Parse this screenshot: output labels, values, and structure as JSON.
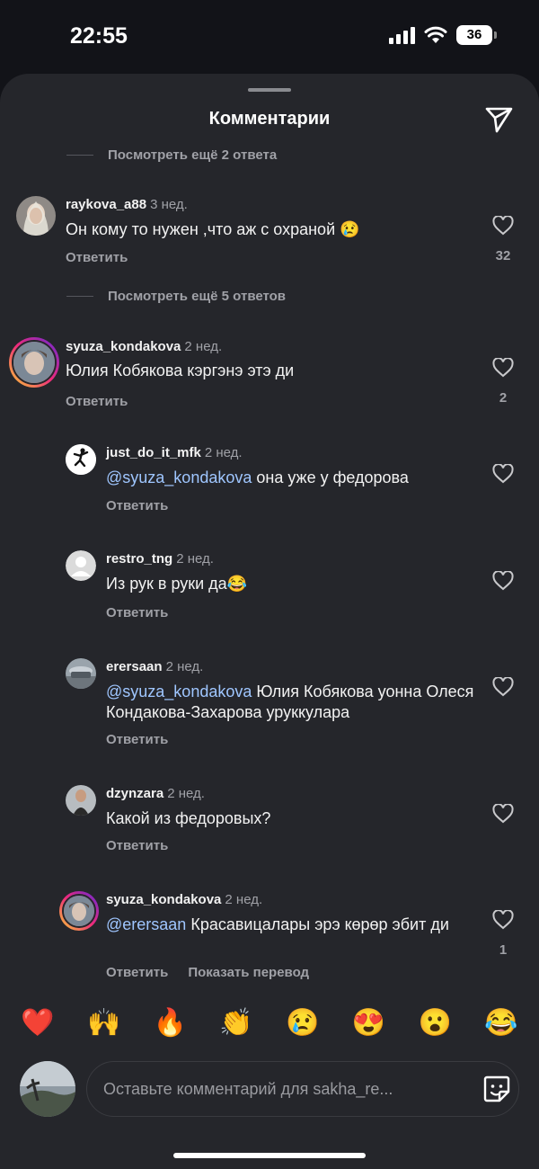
{
  "status": {
    "time": "22:55",
    "battery": "36"
  },
  "sheet": {
    "title": "Комментарии"
  },
  "view_more_1": "Посмотреть ещё 2 ответа",
  "view_more_2": "Посмотреть ещё 5 ответов",
  "comments": [
    {
      "user": "raykova_a88",
      "time": "3 нед.",
      "text": "Он кому то нужен ,что аж с охраной 😢",
      "reply": "Ответить",
      "likes": "32"
    },
    {
      "user": "syuza_kondakova",
      "time": "2 нед.",
      "text": "Юлия Кобякова кэргэнэ этэ ди",
      "reply": "Ответить",
      "likes": "2"
    },
    {
      "user": "just_do_it_mfk",
      "time": "2 нед.",
      "mention": "@syuza_kondakova",
      "text": " она уже у федорова",
      "reply": "Ответить"
    },
    {
      "user": "restro_tng",
      "time": "2 нед.",
      "text": "Из рук в руки да😂",
      "reply": "Ответить"
    },
    {
      "user": "erersaan",
      "time": "2 нед.",
      "mention": "@syuza_kondakova",
      "text": " Юлия Кобякова уонна Олеся Кондакова-Захарова уруккулара",
      "reply": "Ответить"
    },
    {
      "user": "dzynzara",
      "time": "2 нед.",
      "text": "Какой из федоровых?",
      "reply": "Ответить"
    },
    {
      "user": "syuza_kondakova",
      "time": "2 нед.",
      "mention": "@erersaan",
      "text": " Красавицалары эрэ көрөр эбит ди",
      "reply": "Ответить",
      "translate": "Показать перевод",
      "likes": "1"
    }
  ],
  "emoji_bar": [
    "❤️",
    "🙌",
    "🔥",
    "👏",
    "😢",
    "😍",
    "😮",
    "😂"
  ],
  "composer": {
    "placeholder": "Оставьте комментарий для sakha_re..."
  },
  "icons": {
    "send": "paper-plane-icon",
    "heart": "heart-outline-icon",
    "sticker": "sticker-icon",
    "signal": "signal-icon",
    "wifi": "wifi-icon",
    "battery": "battery-icon"
  },
  "colors": {
    "background": "#121318",
    "sheet": "#25262b",
    "mention": "#9fc6ff",
    "secondary_text": "#a0a1a7"
  }
}
